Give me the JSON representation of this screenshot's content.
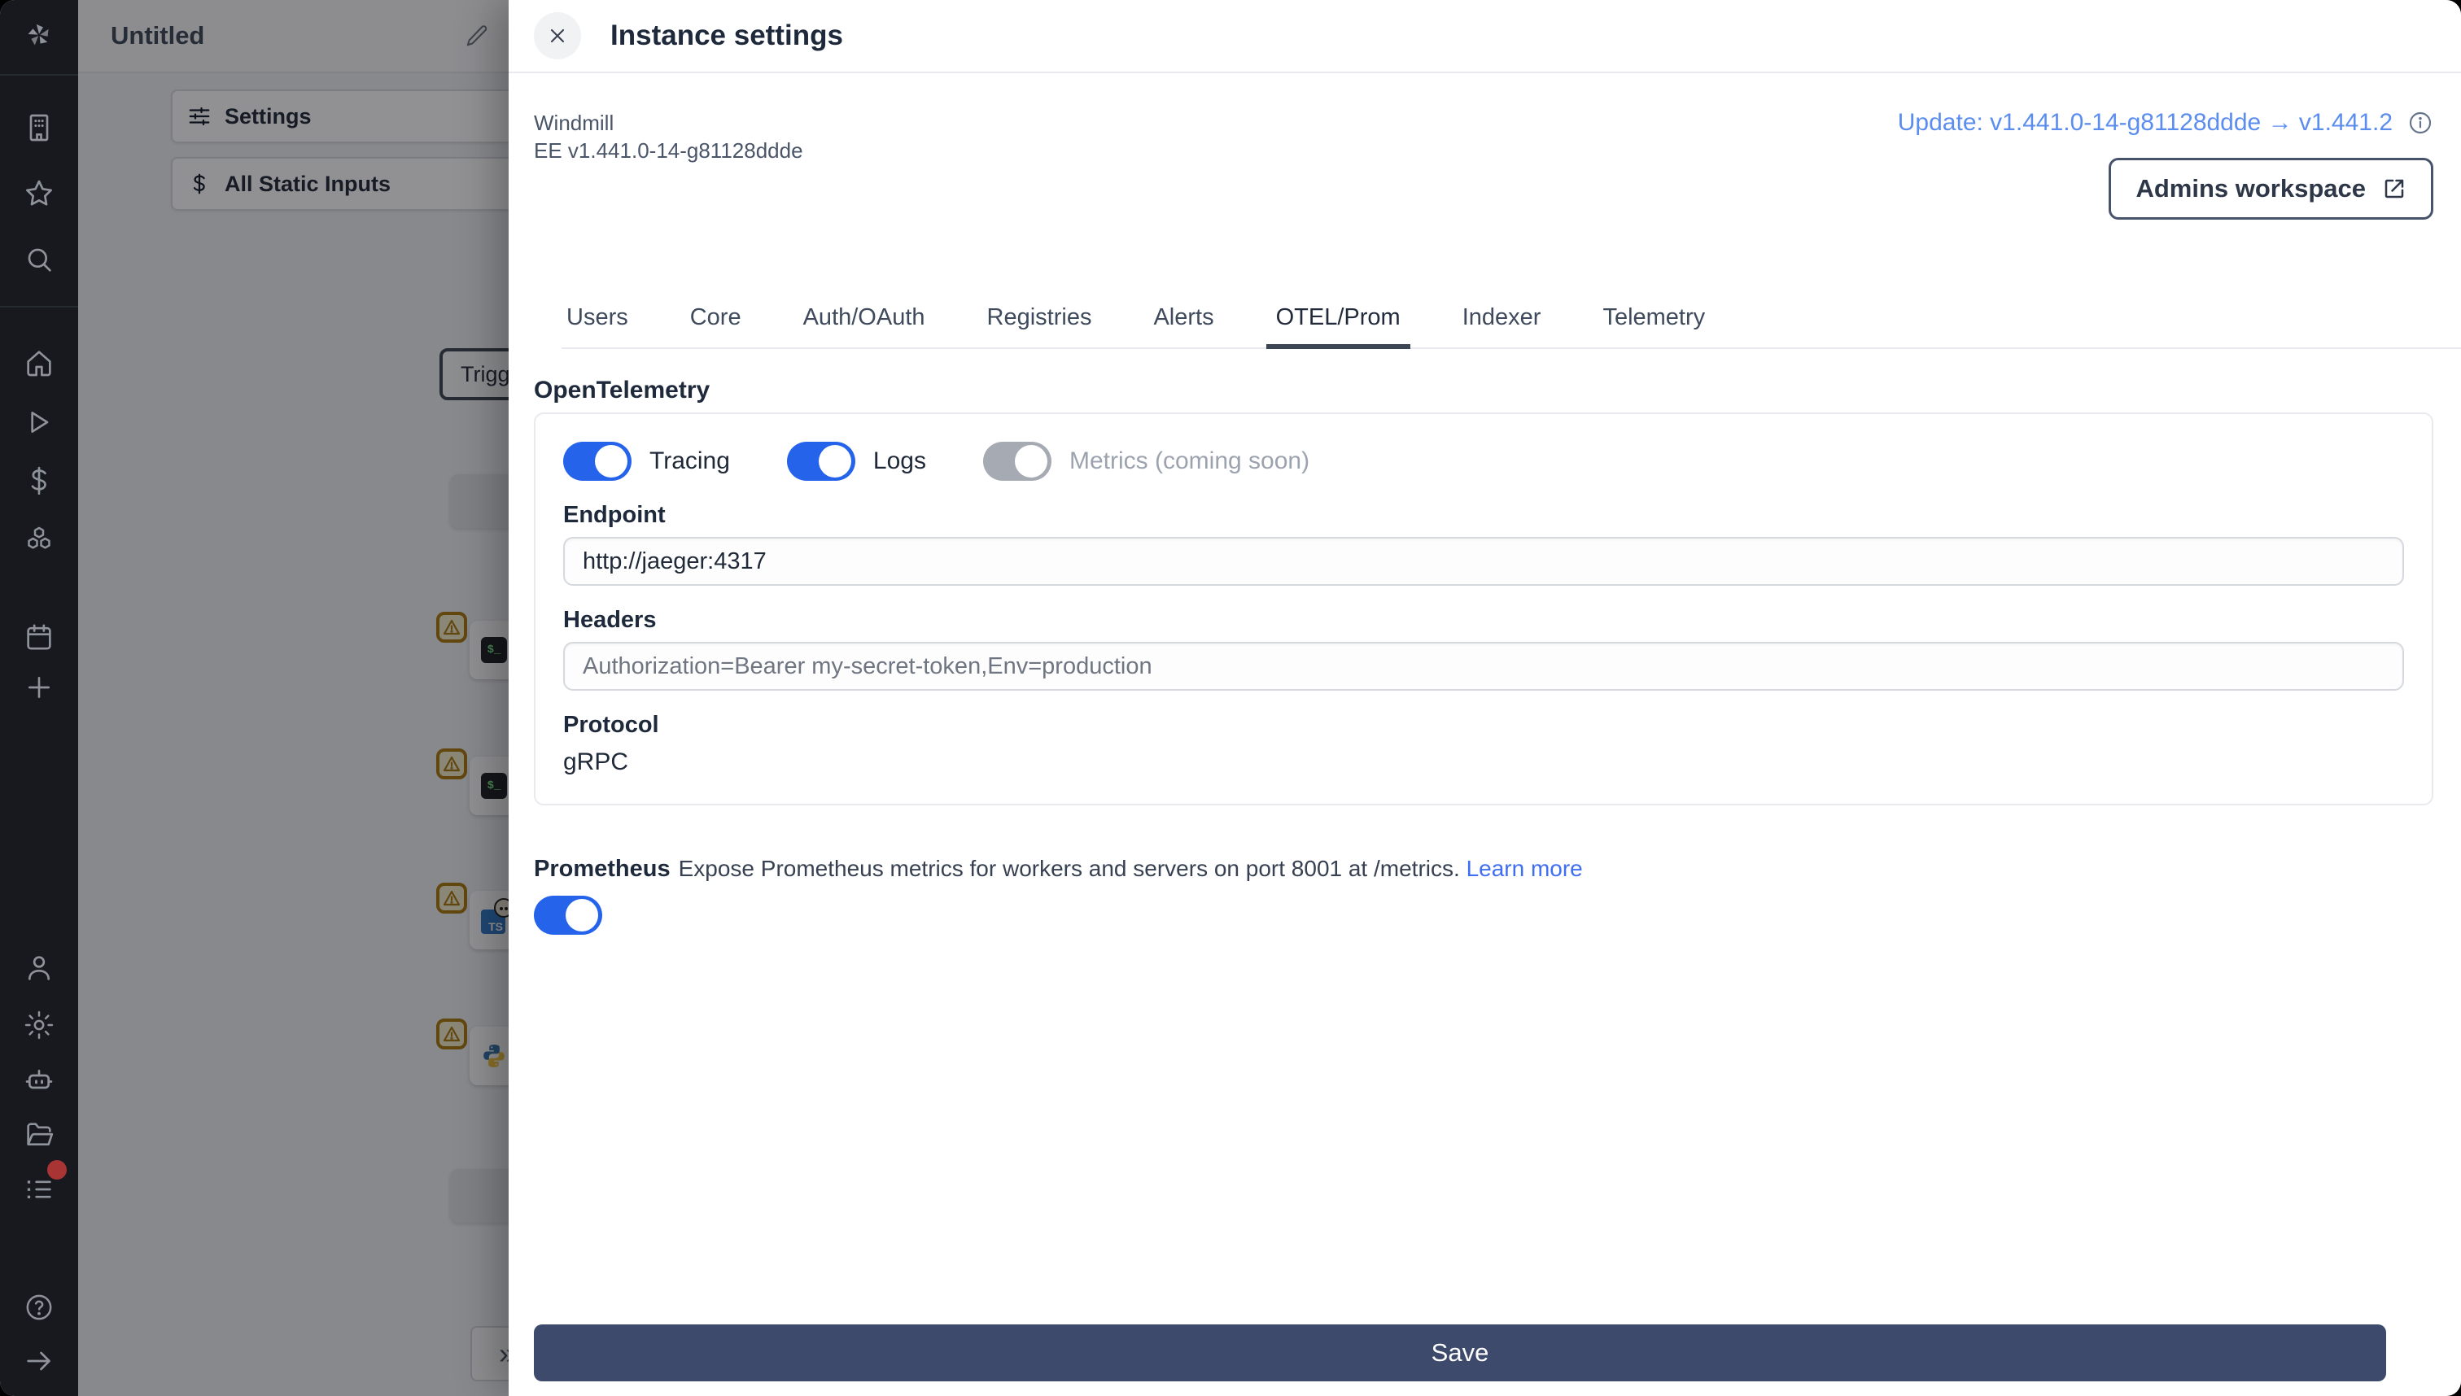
{
  "sidebar": {
    "icons": [
      "windmill-logo",
      "workspace",
      "favorites",
      "search",
      "home",
      "runs",
      "variables",
      "resources",
      "schedules",
      "add",
      "user",
      "settings",
      "workers",
      "folders",
      "audit-logs",
      "help",
      "expand"
    ],
    "has_notification_dot": true
  },
  "left_panel": {
    "title": "Untitled",
    "buttons": [
      {
        "label": "Settings"
      },
      {
        "label": "All Static Inputs"
      }
    ]
  },
  "canvas": {
    "trigger_label": "Trigg",
    "collapse_glyph": "»",
    "bash_glyph": "$_",
    "ts_glyph": "TS",
    "nodes": [
      "placeholder",
      "bash",
      "bash",
      "bun-typescript",
      "python",
      "placeholder"
    ]
  },
  "drawer": {
    "title": "Instance settings",
    "app_name": "Windmill",
    "version": "EE v1.441.0-14-g81128ddde",
    "update_link": "Update: v1.441.0-14-g81128ddde → v1.441.2",
    "workspace_button": "Admins workspace",
    "tabs": [
      "Users",
      "Core",
      "Auth/OAuth",
      "Registries",
      "Alerts",
      "OTEL/Prom",
      "Indexer",
      "Telemetry"
    ],
    "active_tab": "OTEL/Prom",
    "otel": {
      "heading": "OpenTelemetry",
      "toggles": [
        {
          "label": "Tracing",
          "on": true
        },
        {
          "label": "Logs",
          "on": true
        },
        {
          "label": "Metrics (coming soon)",
          "on": false,
          "disabled": true
        }
      ],
      "endpoint_label": "Endpoint",
      "endpoint_value": "http://jaeger:4317",
      "headers_label": "Headers",
      "headers_placeholder": "Authorization=Bearer my-secret-token,Env=production",
      "protocol_label": "Protocol",
      "protocol_value": "gRPC"
    },
    "prometheus": {
      "heading": "Prometheus",
      "description": "Expose Prometheus metrics for workers and servers on port 8001 at /metrics.",
      "learn_more": "Learn more",
      "enabled": true
    },
    "save_label": "Save"
  },
  "colors": {
    "toggle_on": "#2563eb",
    "save_button": "#3e4a6b",
    "update_link": "#5b8def",
    "learn_more_link": "#3f6ef0",
    "sidebar_bg": "#17191e",
    "warning_badge": "#a9780f",
    "notification_dot": "#a83434"
  }
}
